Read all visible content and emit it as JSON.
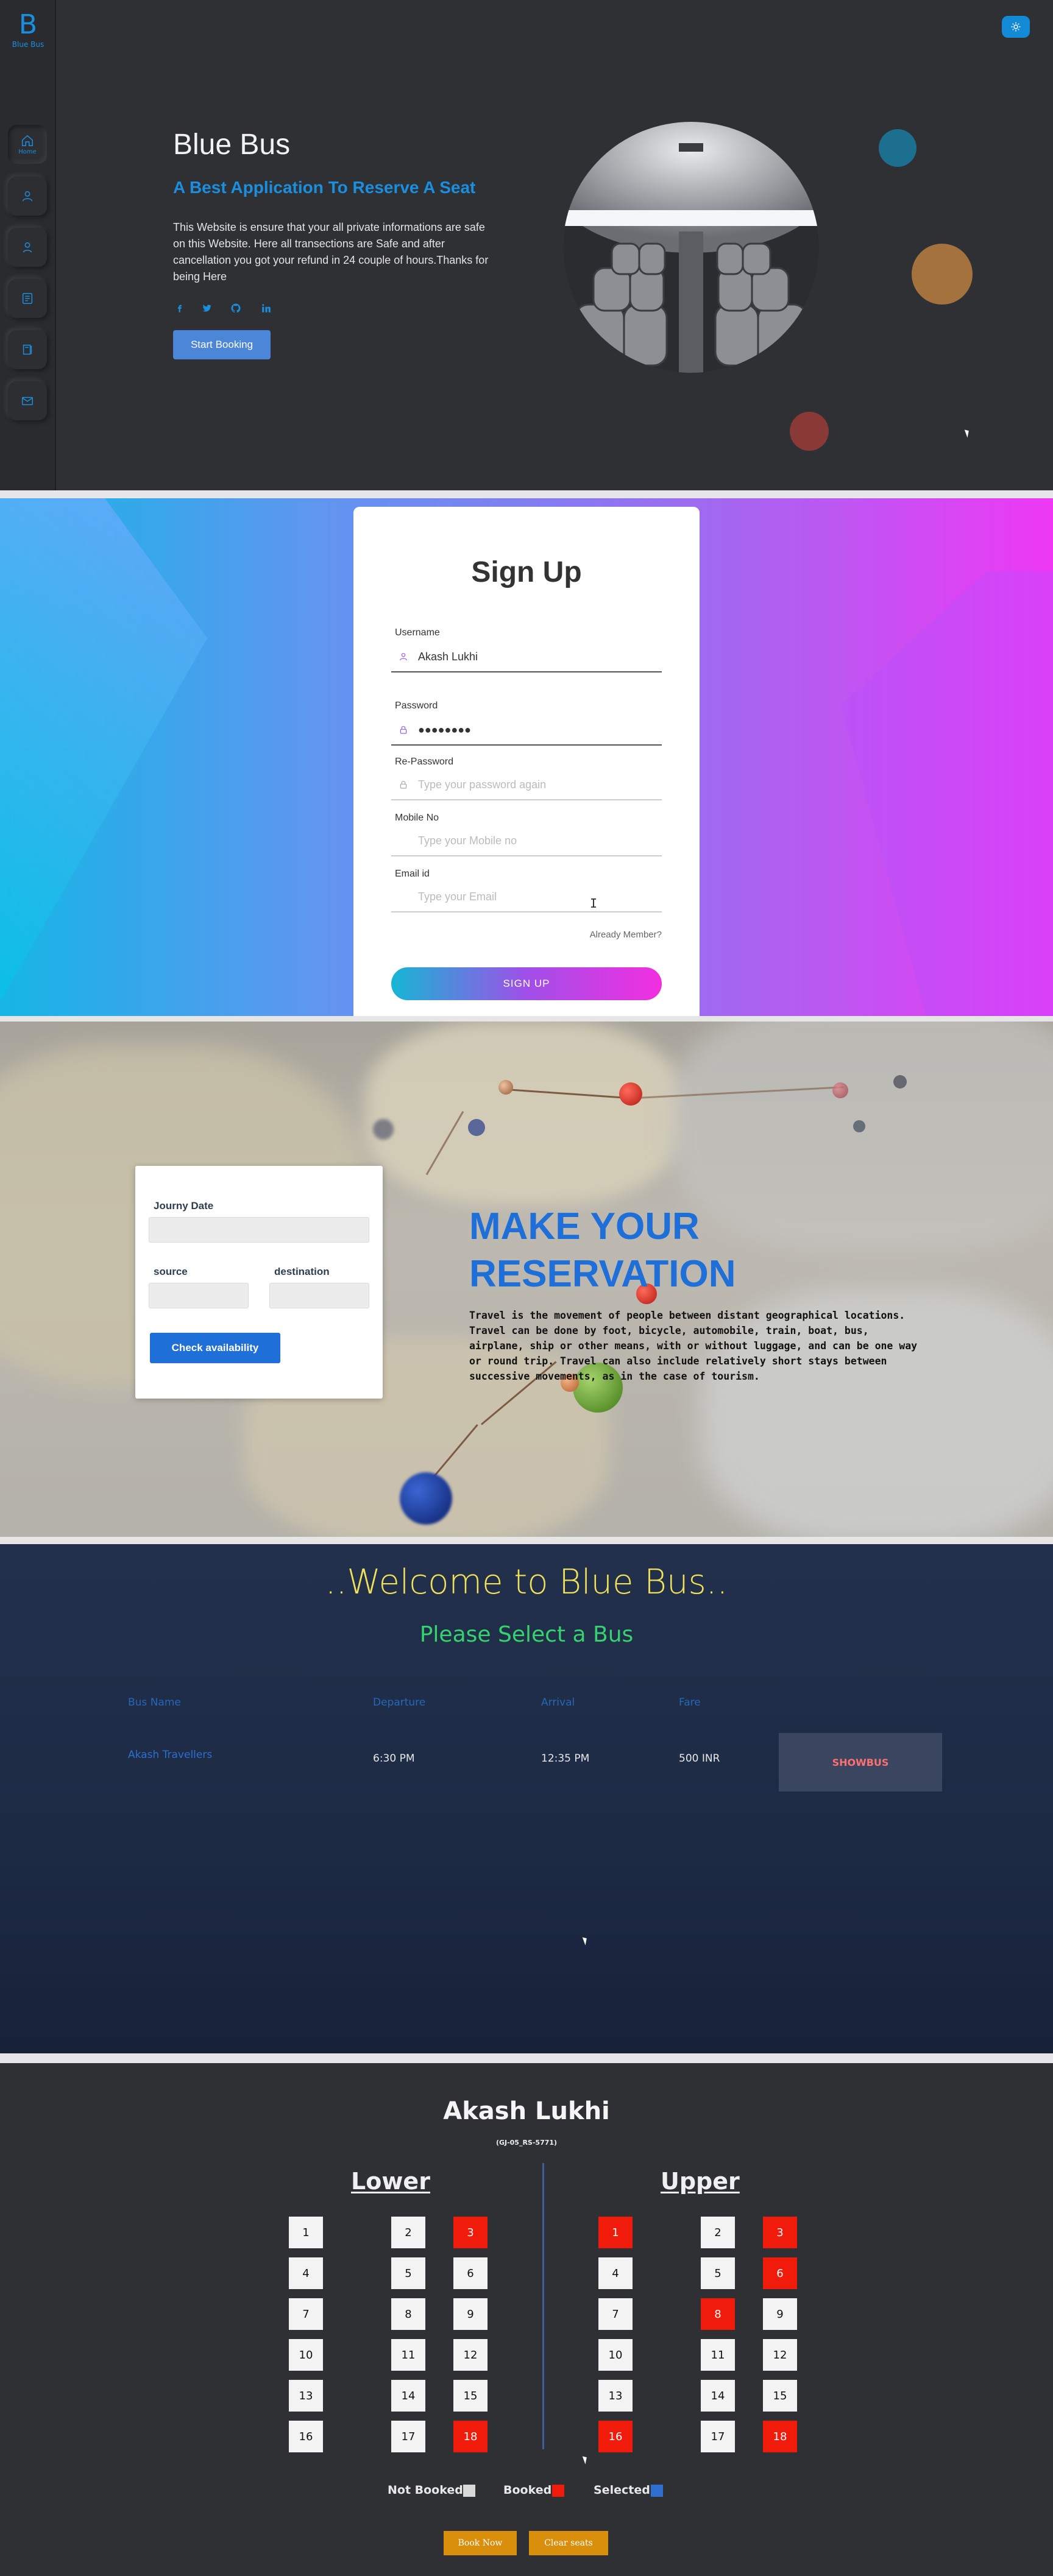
{
  "hero": {
    "logo_letter": "B",
    "logo_text": "Blue Bus",
    "home_label": "Home",
    "sidebar_icons": [
      "home-icon",
      "user-icon",
      "person-icon",
      "list-icon",
      "book-icon",
      "mail-icon"
    ],
    "title": "Blue Bus",
    "subtitle": "A Best Application To Reserve A Seat",
    "description": "This Website is ensure that your all private informations are safe on this Website. Here all transections are Safe and after cancellation you got your refund in 24 couple of hours.Thanks for being Here",
    "social_icons": [
      "facebook-icon",
      "twitter-icon",
      "github-icon",
      "linkedin-icon"
    ],
    "start_button": "Start Booking",
    "accent_color": "#1a8fe0"
  },
  "signup": {
    "title": "Sign Up",
    "username_label": "Username",
    "username_value": "Akash Lukhi",
    "password_label": "Password",
    "password_value": "●●●●●●●●",
    "repassword_label": "Re-Password",
    "repassword_placeholder": "Type your password again",
    "mobile_label": "Mobile No",
    "mobile_placeholder": "Type your Mobile no",
    "email_label": "Email id",
    "email_placeholder": "Type your Email",
    "already_member": "Already Member?",
    "signup_button": "SIGN UP"
  },
  "reservation": {
    "journey_date_label": "Journy Date",
    "source_label": "source",
    "destination_label": "destination",
    "check_button": "Check availability",
    "title": "MAKE YOUR RESERVATION",
    "text": "Travel is the movement of people between distant geographical locations. Travel can be done by foot, bicycle, automobile, train, boat, bus, airplane, ship or other means, with or without luggage, and can be one way or round trip. Travel can also include relatively short stays between successive movements, as in the case of tourism."
  },
  "bus_list": {
    "welcome": "..Welcome to Blue Bus..",
    "subtitle": "Please Select a Bus",
    "headers": {
      "name": "Bus Name",
      "departure": "Departure",
      "arrival": "Arrival",
      "fare": "Fare"
    },
    "rows": [
      {
        "name": "Akash Travellers",
        "departure": "6:30 PM",
        "arrival": "12:35 PM",
        "fare": "500 INR",
        "button": "SHOWBUS"
      }
    ]
  },
  "seats": {
    "title": "Akash Lukhi",
    "registration": "(GJ-05_RS-5771)",
    "lower_title": "Lower",
    "upper_title": "Upper",
    "lower": [
      {
        "n": "1",
        "booked": false
      },
      {
        "n": "2",
        "booked": false
      },
      {
        "n": "3",
        "booked": true
      },
      {
        "n": "4",
        "booked": false
      },
      {
        "n": "5",
        "booked": false
      },
      {
        "n": "6",
        "booked": false
      },
      {
        "n": "7",
        "booked": false
      },
      {
        "n": "8",
        "booked": false
      },
      {
        "n": "9",
        "booked": false
      },
      {
        "n": "10",
        "booked": false
      },
      {
        "n": "11",
        "booked": false
      },
      {
        "n": "12",
        "booked": false
      },
      {
        "n": "13",
        "booked": false
      },
      {
        "n": "14",
        "booked": false
      },
      {
        "n": "15",
        "booked": false
      },
      {
        "n": "16",
        "booked": false
      },
      {
        "n": "17",
        "booked": false
      },
      {
        "n": "18",
        "booked": true
      }
    ],
    "upper": [
      {
        "n": "1",
        "booked": true
      },
      {
        "n": "2",
        "booked": false
      },
      {
        "n": "3",
        "booked": true
      },
      {
        "n": "4",
        "booked": false
      },
      {
        "n": "5",
        "booked": false
      },
      {
        "n": "6",
        "booked": true
      },
      {
        "n": "7",
        "booked": false
      },
      {
        "n": "8",
        "booked": true
      },
      {
        "n": "9",
        "booked": false
      },
      {
        "n": "10",
        "booked": false
      },
      {
        "n": "11",
        "booked": false
      },
      {
        "n": "12",
        "booked": false
      },
      {
        "n": "13",
        "booked": false
      },
      {
        "n": "14",
        "booked": false
      },
      {
        "n": "15",
        "booked": false
      },
      {
        "n": "16",
        "booked": true
      },
      {
        "n": "17",
        "booked": false
      },
      {
        "n": "18",
        "booked": true
      }
    ],
    "legend": {
      "not_booked": "Not Booked",
      "booked": "Booked",
      "selected": "Selected",
      "not_booked_color": "#d9d9d9",
      "booked_color": "#f01b0b",
      "selected_color": "#2f6fd1"
    },
    "book_button": "Book Now",
    "clear_button": "Clear seats"
  }
}
